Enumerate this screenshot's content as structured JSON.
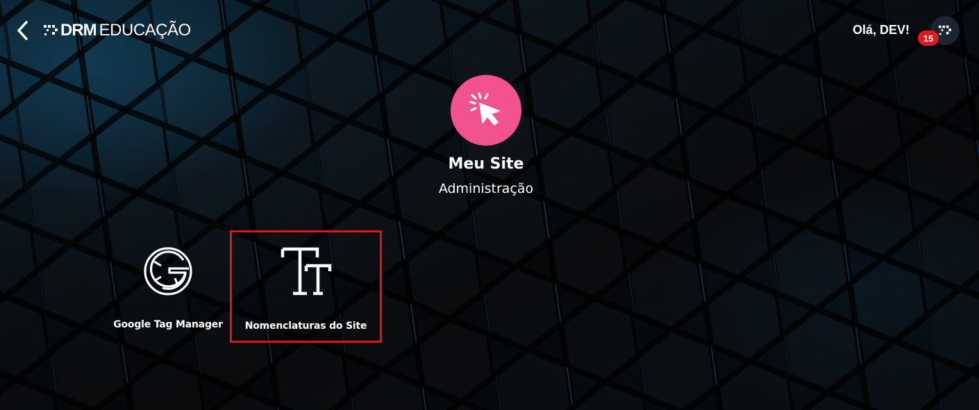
{
  "header": {
    "logo_bold": "DRM",
    "logo_light": "EDUCAÇÃO",
    "greeting": "Olá, DEV!",
    "notification_count": "15"
  },
  "hero": {
    "title": "Meu Site",
    "subtitle": "Administração",
    "icon": "cursor-click-icon",
    "icon_color": "#f2538f"
  },
  "tiles": [
    {
      "label": "Google Tag Manager",
      "icon": "google-g-icon"
    },
    {
      "label": "Nomenclaturas do Site",
      "icon": "text-size-icon",
      "highlighted": true
    }
  ],
  "colors": {
    "highlight_border": "#e3131b",
    "badge": "#e0191f",
    "accent_pink": "#f2538f"
  }
}
